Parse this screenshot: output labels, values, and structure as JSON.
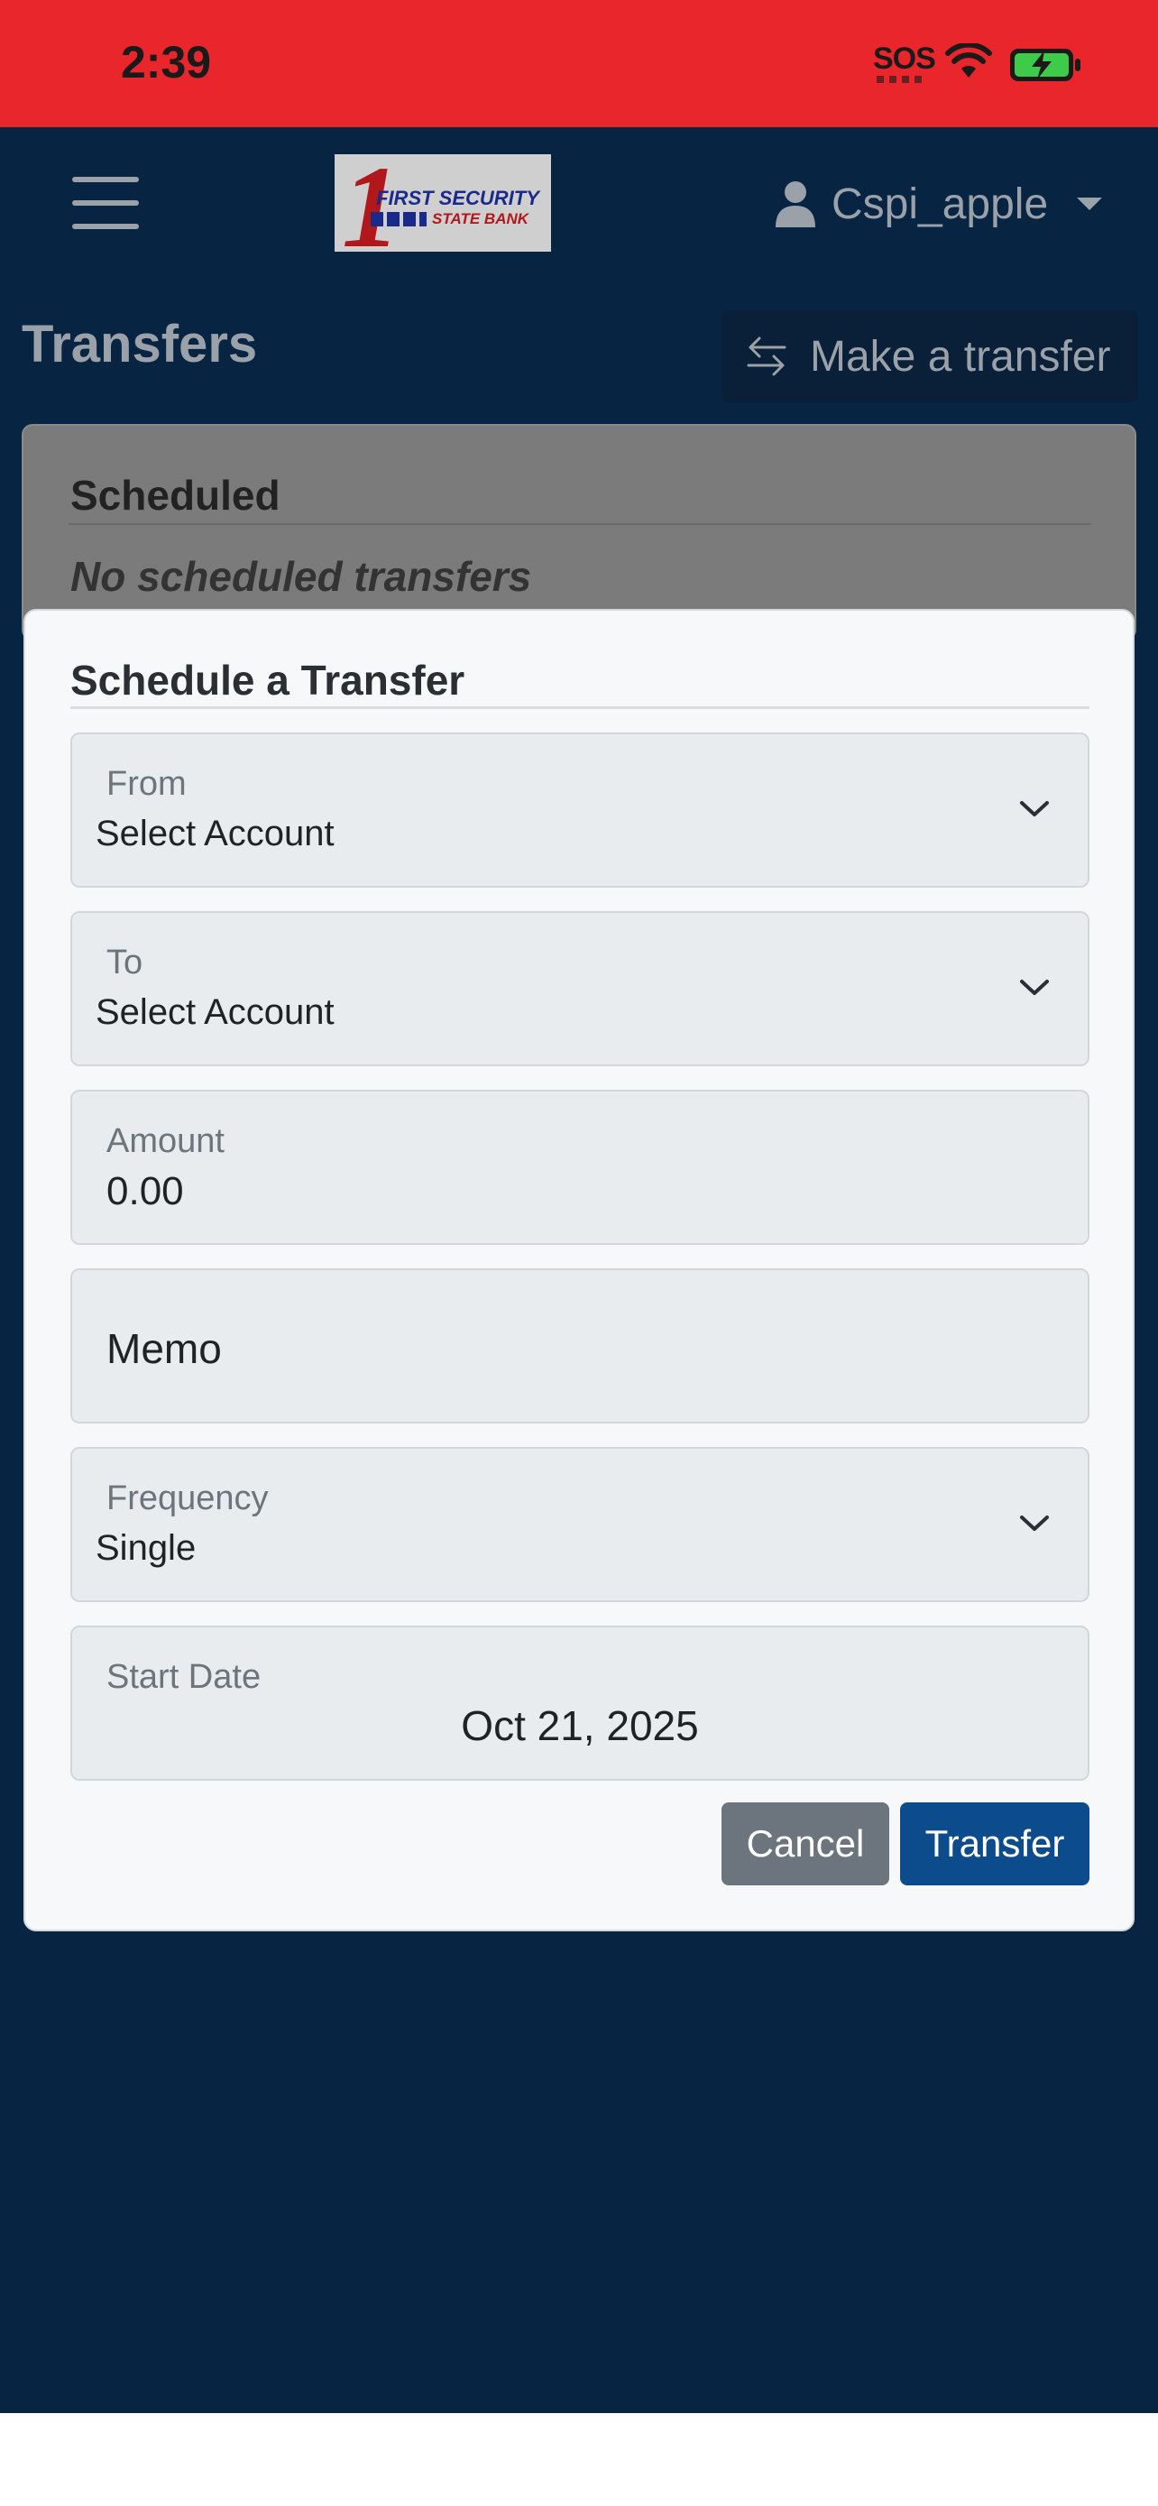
{
  "status_bar": {
    "time": "2:39",
    "sos": "SOS",
    "icons": [
      "wifi-icon",
      "battery-charging-icon"
    ],
    "color": "#e8262b"
  },
  "header": {
    "logo": {
      "numeral": "1",
      "line1": "FIRST SECURITY",
      "line2": "STATE BANK"
    },
    "user": "Cspi_apple"
  },
  "page": {
    "title": "Transfers",
    "make_transfer_label": "Make a transfer"
  },
  "scheduled": {
    "heading": "Scheduled",
    "empty_text": "No scheduled transfers"
  },
  "modal": {
    "title": "Schedule a Transfer",
    "from": {
      "label": "From",
      "value": "Select Account"
    },
    "to": {
      "label": "To",
      "value": "Select Account"
    },
    "amount": {
      "label": "Amount",
      "value": "0.00"
    },
    "memo": {
      "placeholder": "Memo"
    },
    "frequency": {
      "label": "Frequency",
      "value": "Single"
    },
    "start_date": {
      "label": "Start Date",
      "value": "Oct 21, 2025"
    },
    "cancel_label": "Cancel",
    "transfer_label": "Transfer"
  },
  "colors": {
    "app_background": "#072443",
    "primary": "#0d4c8c",
    "secondary": "#6c757d"
  }
}
